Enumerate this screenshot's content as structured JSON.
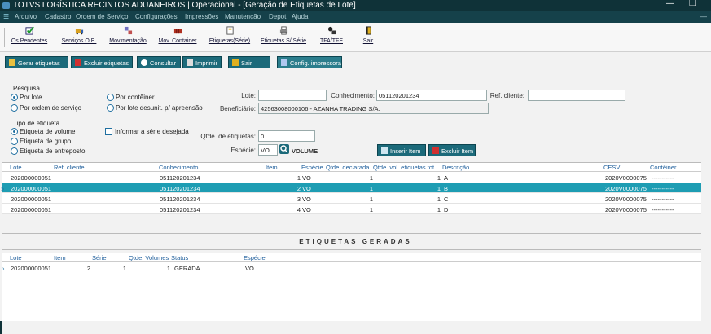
{
  "titlebar": {
    "title": "TOTVS LOGÍSTICA RECINTOS ADUANEIROS | Operacional - [Geração de Etiquetas de Lote]",
    "minimize": "—",
    "restore": "❐"
  },
  "menu": [
    "Arquivo",
    "Cadastro",
    "Ordem de Serviço",
    "Configurações",
    "Impressões",
    "Manutenção",
    "Depot",
    "Ajuda"
  ],
  "menu_right": "—",
  "toolbar": [
    {
      "label": "Os Pendentes",
      "icon": "check-icon"
    },
    {
      "label": "Serviços O.E.",
      "icon": "truck-icon"
    },
    {
      "label": "Movimentação",
      "icon": "move-icon"
    },
    {
      "label": "Mov. Container",
      "icon": "container-icon"
    },
    {
      "label": "Etiquetas(Série)",
      "icon": "label-icon"
    },
    {
      "label": "Etiquetas S/ Série",
      "icon": "printer-icon"
    },
    {
      "label": "TFA/TFE",
      "icon": "tfa-icon"
    },
    {
      "label": "Sair",
      "icon": "exit-icon"
    }
  ],
  "actions": {
    "gerar": "Gerar etiquetas",
    "excluir": "Excluir etiquetas",
    "consultar": "Consultar",
    "imprimir": "Imprimir",
    "sair": "Sair",
    "config": "Config. impressora"
  },
  "pesquisa": {
    "title": "Pesquisa",
    "options": [
      "Por lote",
      "Por contêiner",
      "Por ordem de serviço",
      "Por lote desunit. p/ apreensão"
    ],
    "selected": "Por lote"
  },
  "tipo": {
    "title": "Tipo de etiqueta",
    "options": [
      "Etiqueta de volume",
      "Etiqueta de grupo",
      "Etiqueta de entreposto"
    ],
    "selected": "Etiqueta de volume",
    "checkbox_label": "Informar a série desejada"
  },
  "form": {
    "lote_label": "Lote:",
    "lote_value": "",
    "conhecimento_label": "Conhecimento:",
    "conhecimento_value": "051120201234",
    "refcliente_label": "Ref. cliente:",
    "refcliente_value": "",
    "beneficiario_label": "Beneficiário:",
    "beneficiario_value": "42563008000106 - AZANHA TRADING S/A.",
    "qtde_label": "Qtde. de etiquetas:",
    "qtde_value": "0",
    "especie_label": "Espécie:",
    "especie_value": "VO",
    "especie_desc": "VOLUME",
    "inserir": "Inserir Item",
    "excluir_item": "Excluir Item"
  },
  "items_table": {
    "headers": [
      "Lote",
      "Ref. cliente",
      "Conhecimento",
      "Item",
      "Espécie",
      "Qtde. declarada",
      "Qtde. vol. etiquetas tot.",
      "Descrição",
      "CESV",
      "Contêiner"
    ],
    "rows": [
      [
        "202000000051",
        "",
        "051120201234",
        "1",
        "VO",
        "1",
        "1",
        "A",
        "2020V0000075",
        "-----------"
      ],
      [
        "202000000051",
        "",
        "051120201234",
        "2",
        "VO",
        "1",
        "1",
        "B",
        "2020V0000075",
        "-----------"
      ],
      [
        "202000000051",
        "",
        "051120201234",
        "3",
        "VO",
        "1",
        "1",
        "C",
        "2020V0000075",
        "-----------"
      ],
      [
        "202000000051",
        "",
        "051120201234",
        "4",
        "VO",
        "1",
        "1",
        "D",
        "2020V0000075",
        "-----------"
      ]
    ],
    "selected_marker": "»"
  },
  "generated": {
    "title": "ETIQUETAS GERADAS",
    "headers": [
      "Lote",
      "Item",
      "Série",
      "Qtde. Volumes",
      "Status",
      "Espécie"
    ],
    "rows": [
      [
        "202000000051",
        "2",
        "1",
        "1",
        "GERADA",
        "VO"
      ]
    ],
    "marker": "›"
  },
  "colors": {
    "title_bg": "#0f3238",
    "menu_bg": "#15414a",
    "button": "#1c6a7a",
    "selection": "#1e9db3"
  }
}
